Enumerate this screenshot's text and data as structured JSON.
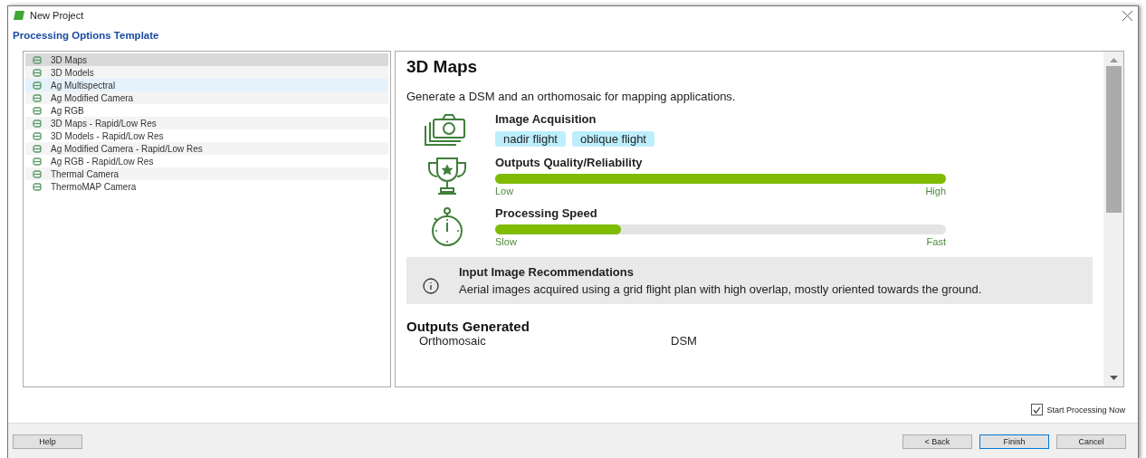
{
  "window": {
    "title": "New Project"
  },
  "heading": "Processing Options Template",
  "templates": [
    {
      "label": "3D Maps",
      "selected": true,
      "hovered": false
    },
    {
      "label": "3D Models",
      "selected": false,
      "hovered": false
    },
    {
      "label": "Ag Multispectral",
      "selected": false,
      "hovered": true
    },
    {
      "label": "Ag Modified Camera",
      "selected": false,
      "hovered": false
    },
    {
      "label": "Ag RGB",
      "selected": false,
      "hovered": false
    },
    {
      "label": "3D Maps - Rapid/Low Res",
      "selected": false,
      "hovered": false
    },
    {
      "label": "3D Models - Rapid/Low Res",
      "selected": false,
      "hovered": false
    },
    {
      "label": "Ag Modified Camera - Rapid/Low Res",
      "selected": false,
      "hovered": false
    },
    {
      "label": "Ag RGB - Rapid/Low Res",
      "selected": false,
      "hovered": false
    },
    {
      "label": "Thermal Camera",
      "selected": false,
      "hovered": false
    },
    {
      "label": "ThermoMAP Camera",
      "selected": false,
      "hovered": false
    }
  ],
  "detail": {
    "title": "3D Maps",
    "description": "Generate a DSM and an orthomosaic for mapping applications.",
    "sections": [
      {
        "kind": "tags",
        "title": "Image Acquisition",
        "tags": [
          "nadir flight",
          "oblique flight"
        ]
      },
      {
        "kind": "meter",
        "title": "Outputs Quality/Reliability",
        "level": 1.0,
        "low": "Low",
        "high": "High"
      },
      {
        "kind": "meter",
        "title": "Processing Speed",
        "level": 0.28,
        "low": "Slow",
        "high": "Fast"
      }
    ],
    "recommendation": {
      "title": "Input Image Recommendations",
      "text": "Aerial images acquired using a grid flight plan with high overlap, mostly oriented towards the ground."
    },
    "outputs_title": "Outputs Generated",
    "outputs": [
      "Orthomosaic",
      "DSM"
    ]
  },
  "start_processing": {
    "label": "Start Processing Now",
    "checked": true
  },
  "buttons": {
    "help": "Help",
    "back": "< Back",
    "finish": "Finish",
    "cancel": "Cancel"
  }
}
